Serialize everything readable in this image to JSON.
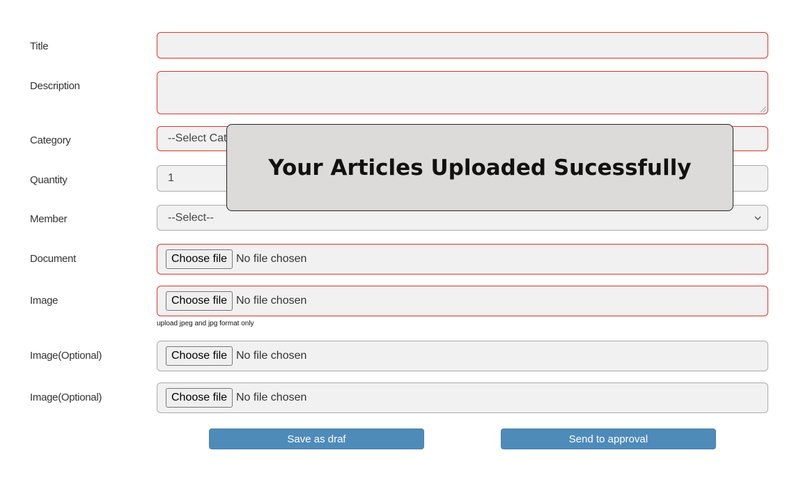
{
  "form": {
    "title": {
      "label": "Title",
      "value": ""
    },
    "description": {
      "label": "Description",
      "value": ""
    },
    "category": {
      "label": "Category",
      "selected": "--Select Category--"
    },
    "quantity": {
      "label": "Quantity",
      "value": "1"
    },
    "member": {
      "label": "Member",
      "selected": "--Select--"
    },
    "document": {
      "label": "Document",
      "button": "Choose file",
      "status": "No file chosen"
    },
    "image": {
      "label": "Image",
      "button": "Choose file",
      "status": "No file chosen",
      "hint": "upload jpeg and jpg format only"
    },
    "image_optional_1": {
      "label": "Image(Optional)",
      "button": "Choose file",
      "status": "No file chosen"
    },
    "image_optional_2": {
      "label": "Image(Optional)",
      "button": "Choose file",
      "status": "No file chosen"
    }
  },
  "actions": {
    "save_draft": "Save as draf",
    "send_approval": "Send to approval"
  },
  "toast": {
    "message": "Your Articles Uploaded Sucessfully"
  },
  "colors": {
    "invalid_border": "#e0322b",
    "button_bg": "#4f8bb9",
    "field_bg": "#f1f1f1",
    "toast_bg": "#dcdbd9"
  }
}
